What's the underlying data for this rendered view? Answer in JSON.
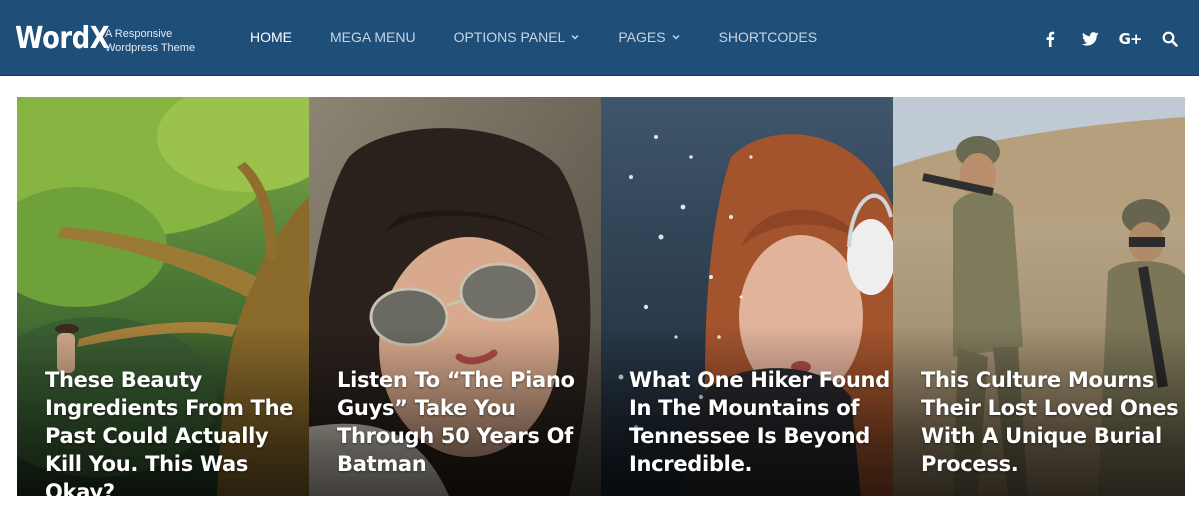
{
  "brand": {
    "logo": "WordX",
    "tagline_line1": "A Responsive",
    "tagline_line2": "Wordpress Theme"
  },
  "nav": {
    "items": [
      {
        "label": "HOME",
        "active": true,
        "has_dropdown": false
      },
      {
        "label": "MEGA MENU",
        "active": false,
        "has_dropdown": false
      },
      {
        "label": "OPTIONS PANEL",
        "active": false,
        "has_dropdown": true
      },
      {
        "label": "PAGES",
        "active": false,
        "has_dropdown": true
      },
      {
        "label": "SHORTCODES",
        "active": false,
        "has_dropdown": false
      }
    ]
  },
  "social": {
    "icons": [
      "facebook-icon",
      "twitter-icon",
      "google-plus-icon",
      "search-icon"
    ],
    "gplus_text": "G+"
  },
  "slider": {
    "cards": [
      {
        "title": "These Beauty Ingredients From The Past Could Actually Kill You. This Was Okay?",
        "image": "tree-and-woman"
      },
      {
        "title": "Listen To “The Piano Guys” Take You Through 50 Years Of Batman",
        "image": "woman-with-sunglasses"
      },
      {
        "title": "What One Hiker Found In The Mountains of Tennessee Is Beyond Incredible.",
        "image": "woman-blowing-snow"
      },
      {
        "title": "This Culture Mourns Their Lost Loved Ones With A Unique Burial Process.",
        "image": "soldiers-in-desert"
      }
    ]
  },
  "colors": {
    "header_bg": "#1f4e79",
    "nav_text": "#c6d5e4",
    "nav_active": "#ffffff"
  }
}
